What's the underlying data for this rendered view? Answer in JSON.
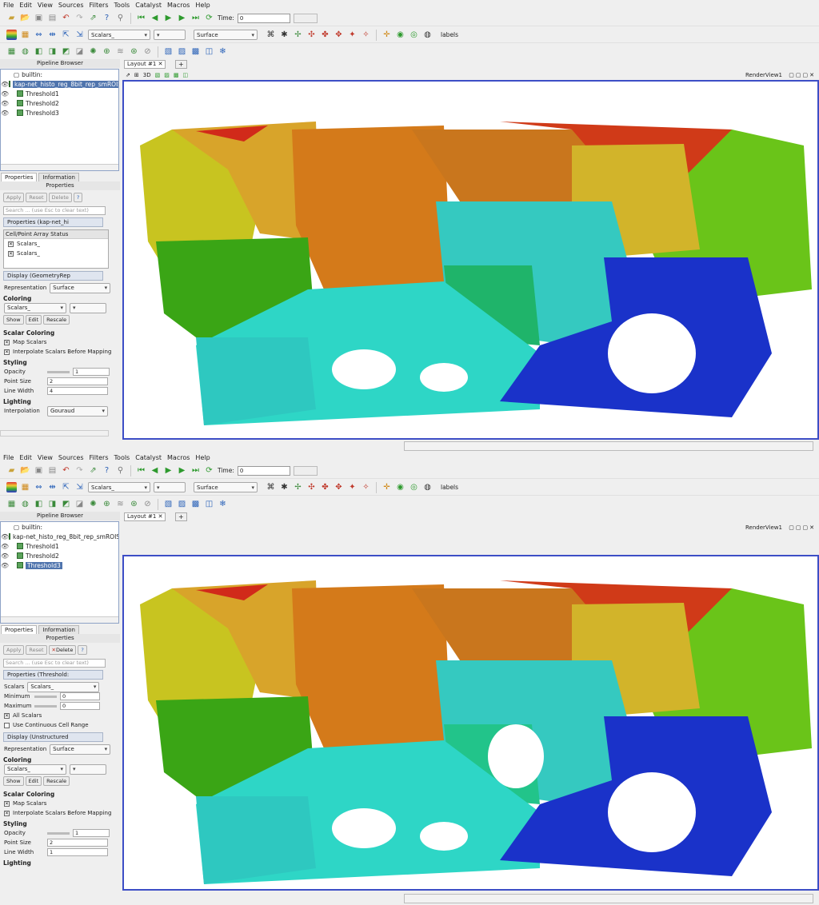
{
  "menu": [
    "File",
    "Edit",
    "View",
    "Sources",
    "Filters",
    "Tools",
    "Catalyst",
    "Macros",
    "Help"
  ],
  "toolbar": {
    "time_label": "Time:",
    "time_value": "0",
    "scalars_combo": "Scalars_",
    "representation_combo": "Surface",
    "labels_text": "labels"
  },
  "pipeline": {
    "title": "Pipeline Browser",
    "builtin": "builtin:",
    "source": "kap-net_histo_reg_8bit_rep_smROIS",
    "items": [
      "Threshold1",
      "Threshold2",
      "Threshold3"
    ]
  },
  "tabs": {
    "properties": "Properties",
    "information": "Information"
  },
  "props_title": "Properties",
  "buttons": {
    "apply": "Apply",
    "reset": "Reset",
    "delete": "Delete",
    "help": "?"
  },
  "search_placeholder": "Search ... (use Esc to clear text)",
  "top": {
    "properties_section": "Properties (kap-net_hi",
    "array_status_header": "Cell/Point Array Status",
    "arrays": [
      "Scalars_",
      "Scalars_"
    ],
    "display_section": "Display (GeometryRep",
    "representation_label": "Representation",
    "representation_value": "Surface",
    "coloring_head": "Coloring",
    "coloring_value": "Scalars_",
    "show": "Show",
    "edit": "Edit",
    "rescale": "Rescale",
    "scalar_coloring_head": "Scalar Coloring",
    "map_scalars": "Map Scalars",
    "interpolate": "Interpolate Scalars Before Mapping",
    "styling_head": "Styling",
    "opacity_label": "Opacity",
    "opacity_value": "1",
    "point_size_label": "Point Size",
    "point_size_value": "2",
    "line_width_label": "Line Width",
    "line_width_value": "4",
    "lighting_head": "Lighting",
    "interpolation_label": "Interpolation",
    "interpolation_value": "Gouraud"
  },
  "bottom": {
    "properties_section": "Properties (Threshold:",
    "scalars_label": "Scalars",
    "scalars_value": "Scalars_",
    "minimum_label": "Minimum",
    "minimum_value": "0",
    "maximum_label": "Maximum",
    "maximum_value": "0",
    "all_scalars": "All Scalars",
    "continuous": "Use Continuous Cell Range",
    "display_section": "Display (Unstructured",
    "representation_label": "Representation",
    "representation_value": "Surface",
    "coloring_head": "Coloring",
    "coloring_value": "Scalars_",
    "show": "Show",
    "edit": "Edit",
    "rescale": "Rescale",
    "scalar_coloring_head": "Scalar Coloring",
    "map_scalars": "Map Scalars",
    "interpolate": "Interpolate Scalars Before Mapping",
    "styling_head": "Styling",
    "opacity_label": "Opacity",
    "opacity_value": "1",
    "point_size_label": "Point Size",
    "point_size_value": "2",
    "line_width_label": "Line Width",
    "line_width_value": "1",
    "lighting_head": "Lighting"
  },
  "layout_tab": "Layout #1",
  "render_view": "RenderView1",
  "colors": {
    "selection": "#4f74ad",
    "frame": "#3d4ec6"
  }
}
